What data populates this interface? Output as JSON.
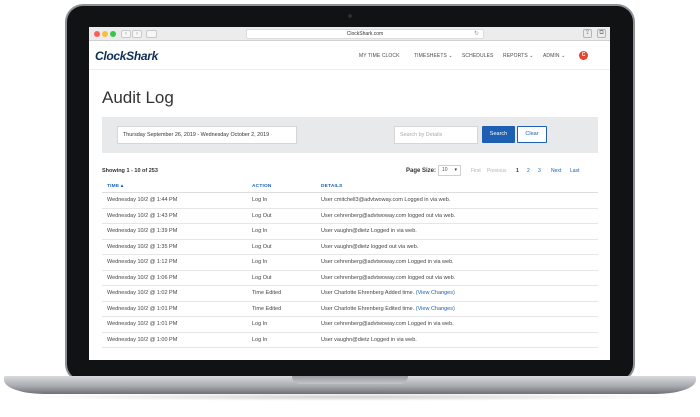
{
  "browser": {
    "url": "ClockShark.com"
  },
  "app": {
    "logo": "ClockShark",
    "nav": [
      {
        "label": "MY TIME CLOCK"
      },
      {
        "label": "TIMESHEETS ⌄"
      },
      {
        "label": "SCHEDULES"
      },
      {
        "label": "REPORTS ⌄"
      },
      {
        "label": "ADMIN ⌄"
      }
    ],
    "avatar_initial": "C"
  },
  "page": {
    "title": "Audit Log"
  },
  "filters": {
    "date_range": "Thursday September 26, 2019 - Wednesday October 2, 2019",
    "search_placeholder": "Search by Details",
    "search_label": "Search",
    "clear_label": "Clear"
  },
  "results": {
    "showing": "Showing 1 - 10 of 253",
    "page_size_label": "Page Size:",
    "page_size_value": "10",
    "pager": {
      "first": "First",
      "previous": "Previous",
      "pages": [
        "1",
        "2",
        "3"
      ],
      "current": "1",
      "next": "Next",
      "last": "Last"
    }
  },
  "table": {
    "columns": [
      "TIME ▴",
      "ACTION",
      "DETAILS"
    ],
    "rows": [
      {
        "time": "Wednesday 10/2 @ 1:44 PM",
        "action": "Log In",
        "details": "User cmitchell3@advtwoway.com Logged in via web.",
        "link": ""
      },
      {
        "time": "Wednesday 10/2 @ 1:43 PM",
        "action": "Log Out",
        "details": "User cehrenberg@advtwoway.com logged out via web.",
        "link": ""
      },
      {
        "time": "Wednesday 10/2 @ 1:39 PM",
        "action": "Log In",
        "details": "User vaughn@dietz Logged in via web.",
        "link": ""
      },
      {
        "time": "Wednesday 10/2 @ 1:35 PM",
        "action": "Log Out",
        "details": "User vaughn@dietz logged out via web.",
        "link": ""
      },
      {
        "time": "Wednesday 10/2 @ 1:12 PM",
        "action": "Log In",
        "details": "User cehrenberg@advtwoway.com Logged in via web.",
        "link": ""
      },
      {
        "time": "Wednesday 10/2 @ 1:06 PM",
        "action": "Log Out",
        "details": "User cehrenberg@advtwoway.com logged out via web.",
        "link": ""
      },
      {
        "time": "Wednesday 10/2 @ 1:02 PM",
        "action": "Time Edited",
        "details": "User Charlotte Ehrenberg Added time.",
        "link": "(View Changes)"
      },
      {
        "time": "Wednesday 10/2 @ 1:01 PM",
        "action": "Time Edited",
        "details": "User Charlotte Ehrenberg Edited time.",
        "link": "(View Changes)"
      },
      {
        "time": "Wednesday 10/2 @ 1:01 PM",
        "action": "Log In",
        "details": "User cehrenberg@advtwoway.com Logged in via web.",
        "link": ""
      },
      {
        "time": "Wednesday 10/2 @ 1:00 PM",
        "action": "Log In",
        "details": "User vaughn@dietz Logged in via web.",
        "link": ""
      }
    ]
  }
}
